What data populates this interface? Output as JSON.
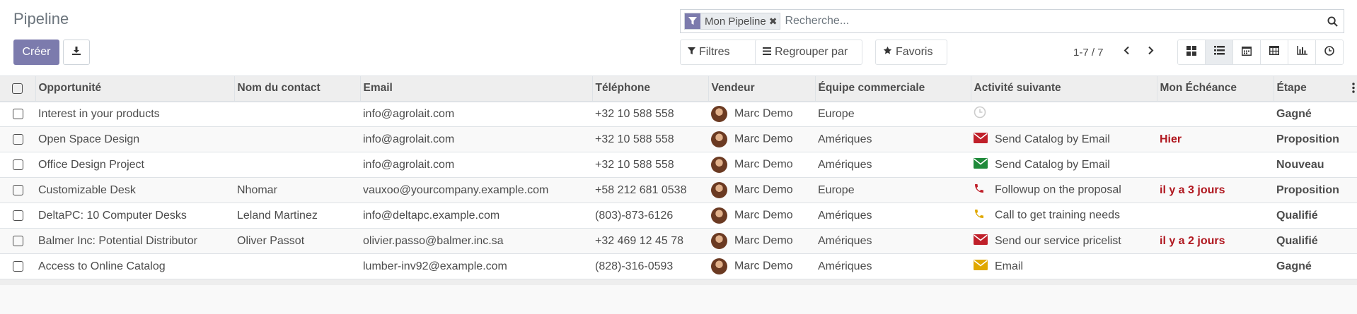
{
  "page": {
    "title": "Pipeline"
  },
  "actions": {
    "create_label": "Créer",
    "download_icon": "download-icon"
  },
  "search": {
    "facet_label": "Mon Pipeline",
    "facet_icon": "filter-icon",
    "placeholder": "Recherche..."
  },
  "filters": {
    "filters_label": "Filtres",
    "group_label": "Regrouper par",
    "favorites_label": "Favoris"
  },
  "pager": {
    "text": "1-7 / 7"
  },
  "views": [
    "kanban",
    "list",
    "calendar",
    "pivot",
    "graph",
    "activity"
  ],
  "colors": {
    "accent": "#7c7bad",
    "overdue": "#b0171f",
    "email_red": "#c0202a",
    "email_green": "#1f8a3a",
    "email_yellow": "#e0a800",
    "phone_red": "#c0202a",
    "phone_yellow": "#e0a800"
  },
  "table": {
    "columns": [
      "Opportunité",
      "Nom du contact",
      "Email",
      "Téléphone",
      "Vendeur",
      "Équipe commerciale",
      "Activité suivante",
      "Mon Échéance",
      "Étape"
    ],
    "rows": [
      {
        "opportunity": "Interest in your products",
        "contact": "",
        "email": "info@agrolait.com",
        "phone": "+32 10 588 558",
        "salesperson": "Marc Demo",
        "team": "Europe",
        "activity": "",
        "activity_icon": "clock-icon",
        "activity_color": "#cccccc",
        "deadline": "",
        "stage": "Gagné"
      },
      {
        "opportunity": "Open Space Design",
        "contact": "",
        "email": "info@agrolait.com",
        "phone": "+32 10 588 558",
        "salesperson": "Marc Demo",
        "team": "Amériques",
        "activity": "Send Catalog by Email",
        "activity_icon": "envelope-icon",
        "activity_color": "#c0202a",
        "deadline": "Hier",
        "stage": "Proposition"
      },
      {
        "opportunity": "Office Design Project",
        "contact": "",
        "email": "info@agrolait.com",
        "phone": "+32 10 588 558",
        "salesperson": "Marc Demo",
        "team": "Amériques",
        "activity": "Send Catalog by Email",
        "activity_icon": "envelope-icon",
        "activity_color": "#1f8a3a",
        "deadline": "",
        "stage": "Nouveau"
      },
      {
        "opportunity": "Customizable Desk",
        "contact": "Nhomar",
        "email": "vauxoo@yourcompany.example.com",
        "phone": "+58 212 681 0538",
        "salesperson": "Marc Demo",
        "team": "Europe",
        "activity": "Followup on the proposal",
        "activity_icon": "phone-icon",
        "activity_color": "#c0202a",
        "deadline": "il y a 3 jours",
        "stage": "Proposition"
      },
      {
        "opportunity": "DeltaPC: 10 Computer Desks",
        "contact": "Leland Martinez",
        "email": "info@deltapc.example.com",
        "phone": "(803)-873-6126",
        "salesperson": "Marc Demo",
        "team": "Amériques",
        "activity": "Call to get training needs",
        "activity_icon": "phone-icon",
        "activity_color": "#e0a800",
        "deadline": "",
        "stage": "Qualifié"
      },
      {
        "opportunity": "Balmer Inc: Potential Distributor",
        "contact": "Oliver Passot",
        "email": "olivier.passo@balmer.inc.sa",
        "phone": "+32 469 12 45 78",
        "salesperson": "Marc Demo",
        "team": "Amériques",
        "activity": "Send our service pricelist",
        "activity_icon": "envelope-icon",
        "activity_color": "#c0202a",
        "deadline": "il y a 2 jours",
        "stage": "Qualifié"
      },
      {
        "opportunity": "Access to Online Catalog",
        "contact": "",
        "email": "lumber-inv92@example.com",
        "phone": "(828)-316-0593",
        "salesperson": "Marc Demo",
        "team": "Amériques",
        "activity": "Email",
        "activity_icon": "envelope-icon",
        "activity_color": "#e0a800",
        "deadline": "",
        "stage": "Gagné"
      }
    ]
  }
}
